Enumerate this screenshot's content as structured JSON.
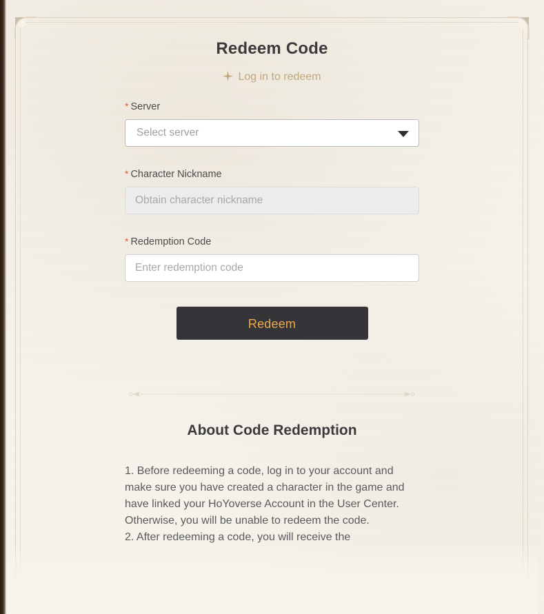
{
  "page": {
    "title": "Redeem Code",
    "accent_gold": "#c0a87c",
    "button_bg": "#353539",
    "button_text_color": "#f0a945",
    "required_mark_color": "#e8563f",
    "paper_bg": "#f7f4ec"
  },
  "login": {
    "icon": "sparkle-icon",
    "label": "Log in to redeem"
  },
  "form": {
    "required_mark": "*",
    "server": {
      "label": "Server",
      "placeholder": "Select server",
      "value": "",
      "caret_icon": "chevron-down-icon"
    },
    "nickname": {
      "label": "Character Nickname",
      "placeholder": "Obtain character nickname",
      "value": "",
      "disabled": true
    },
    "code": {
      "label": "Redemption Code",
      "placeholder": "Enter redemption code",
      "value": ""
    },
    "submit_label": "Redeem"
  },
  "about": {
    "heading": "About Code Redemption",
    "body": "1. Before redeeming a code, log in to your account and make sure you have created a character in the game and have linked your HoYoverse Account in the User Center. Otherwise, you will be unable to redeem the code.\n2. After redeeming a code, you will receive the"
  }
}
